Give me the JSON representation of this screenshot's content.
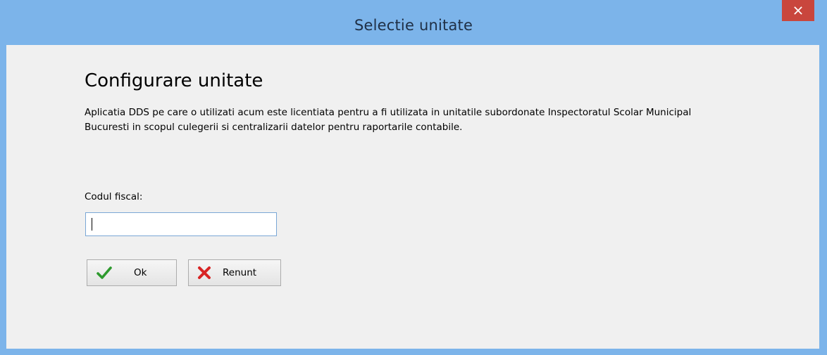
{
  "window": {
    "title": "Selectie unitate"
  },
  "content": {
    "heading": "Configurare unitate",
    "description": "Aplicatia DDS pe care o utilizati acum este licentiata pentru a fi utilizata in unitatile subordonate Inspectoratul Scolar Municipal Bucuresti in scopul culegerii si centralizarii datelor pentru raportarile contabile.",
    "fiscal_code": {
      "label": "Codul fiscal:",
      "value": ""
    }
  },
  "buttons": {
    "ok": {
      "label": "Ok",
      "icon": "checkmark-icon",
      "icon_color": "#2e9a2e"
    },
    "cancel": {
      "label": "Renunt",
      "icon": "x-mark-icon",
      "icon_color": "#d82424"
    }
  },
  "colors": {
    "titlebar": "#7cb4ea",
    "close_button": "#c9463d",
    "client_background": "#f0f0f0"
  }
}
